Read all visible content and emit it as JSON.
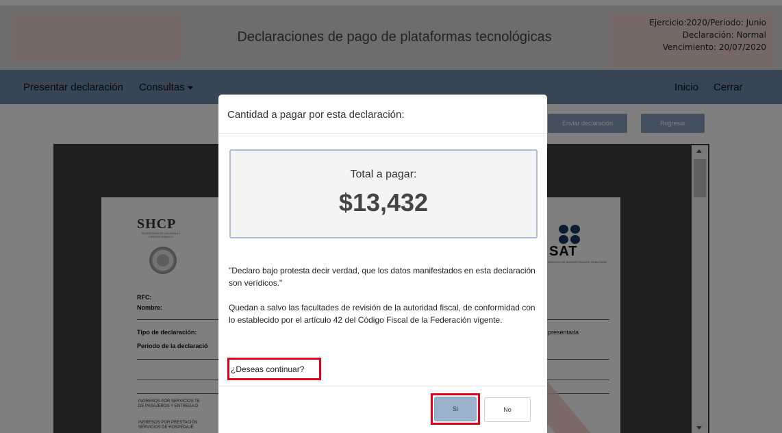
{
  "header": {
    "title": "Declaraciones de pago de plataformas tecnológicas",
    "period_line1": "Ejercicio:2020/Periodo: Junio",
    "period_line2": "Declaración: Normal",
    "period_line3": "Vencimiento: 20/07/2020"
  },
  "nav": {
    "present": "Presentar declaración",
    "consultas": "Consultas",
    "inicio": "Inicio",
    "cerrar": "Cerrar"
  },
  "toolbar": {
    "enviar": "Enviar declaración",
    "regresar": "Regresar"
  },
  "document": {
    "shcp": "SHCP",
    "shcp_sub": "SECRETARÍA DE HACIENDA Y CRÉDITO PÚBLICO",
    "sat": "SAT",
    "sat_sub": "SERVICIO DE ADMINISTRACIÓN TRIBUTARIA",
    "rfc_label": "RFC:",
    "nombre_label": "Nombre:",
    "tipo_label": "Tipo de declaración:",
    "periodo_label": "Periodo de la declaració",
    "presentada": "presentada",
    "ingresos1_line1": "INGRESOS POR SERVICIOS TE",
    "ingresos1_line2": "DE PASAJEROS Y ENTREGA D",
    "ingresos2_line1": "INGRESOS POR PRESTACIÓN",
    "ingresos2_line2": "SERVICIOS DE HOSPEDAJE"
  },
  "modal": {
    "title": "Cantidad a pagar por esta declaración:",
    "total_label": "Total a pagar:",
    "total_amount": "$13,432",
    "declaro": "\"Declaro bajo protesta decir verdad, que los datos manifestados en esta declaración son verídicos.\"",
    "facultades": "Quedan a salvo las facultades de revisión de la autoridad fiscal, de conformidad con lo establecido por el artículo 42 del Código Fiscal de la Federación vigente.",
    "continuar": "¿Deseas continuar?",
    "si": "Sí",
    "no": "No"
  },
  "colors": {
    "navbar": "#6f8aa8",
    "highlight": "#e0001b",
    "primary_button": "#9bb2cc"
  }
}
